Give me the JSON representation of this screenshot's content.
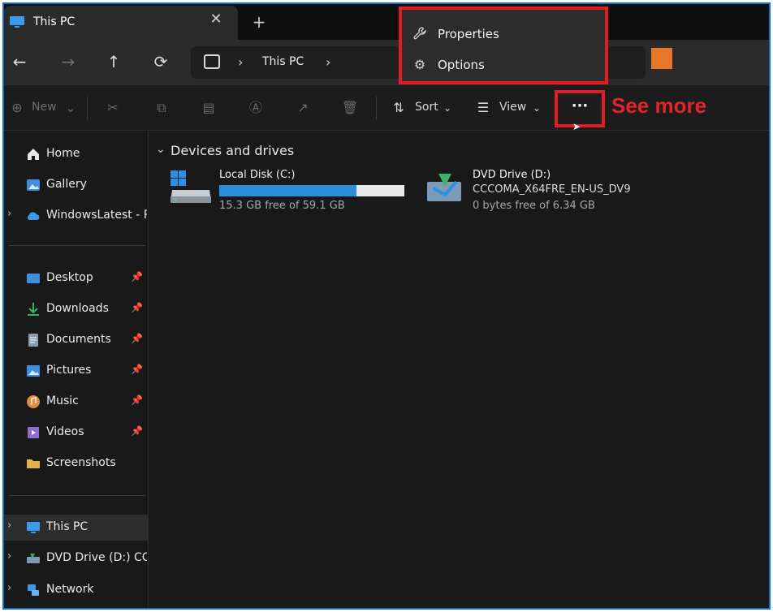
{
  "window": {
    "tab_title": "This PC",
    "tab_close": "✕",
    "new_tab": "+"
  },
  "nav": {
    "back": "←",
    "forward": "→",
    "up": "↑",
    "refresh": "⟳",
    "breadcrumb": "This PC",
    "chevron": "›"
  },
  "menu": {
    "items": [
      {
        "label": "Properties",
        "icon": "wrench-icon",
        "glyph": "🔧"
      },
      {
        "label": "Options",
        "icon": "gear-icon",
        "glyph": "⚙"
      }
    ]
  },
  "toolbar": {
    "new_label": "New",
    "sort_label": "Sort",
    "view_label": "View",
    "see_more_label": "···",
    "annotation": "See more"
  },
  "sidebar": {
    "items": [
      {
        "label": "Home",
        "icon": "home-icon",
        "color": "#e8e8e8"
      },
      {
        "label": "Gallery",
        "icon": "gallery-icon",
        "color": "#3c8ede"
      },
      {
        "label": "WindowsLatest - Pe",
        "icon": "cloud-icon",
        "color": "#3c9ae8"
      },
      {
        "label": "Desktop",
        "icon": "desktop-icon",
        "color": "#3c8ede"
      },
      {
        "label": "Downloads",
        "icon": "download-icon",
        "color": "#3fae6a"
      },
      {
        "label": "Documents",
        "icon": "documents-icon",
        "color": "#8a9bb0"
      },
      {
        "label": "Pictures",
        "icon": "pictures-icon",
        "color": "#3c8ede"
      },
      {
        "label": "Music",
        "icon": "music-icon",
        "color": "#e58a3a"
      },
      {
        "label": "Videos",
        "icon": "videos-icon",
        "color": "#8c6ccf"
      },
      {
        "label": "Screenshots",
        "icon": "folder-icon",
        "color": "#e2b34a"
      },
      {
        "label": "This PC",
        "icon": "computer-icon",
        "color": "#3c9ae8"
      },
      {
        "label": "DVD Drive (D:) CCC",
        "icon": "dvd-icon",
        "color": "#3fae6a"
      },
      {
        "label": "Network",
        "icon": "network-icon",
        "color": "#3c9ae8"
      }
    ]
  },
  "content": {
    "group_title": "Devices and drives",
    "drives": [
      {
        "name": "Local Disk (C:)",
        "free": "15.3 GB free of 59.1 GB",
        "used_fraction": 0.74
      },
      {
        "name": "DVD Drive (D:)",
        "label": "CCCOMA_X64FRE_EN-US_DV9",
        "free": "0 bytes free of 6.34 GB"
      }
    ]
  },
  "colors": {
    "highlight": "#e31b23",
    "accent": "#2b8ed8"
  }
}
